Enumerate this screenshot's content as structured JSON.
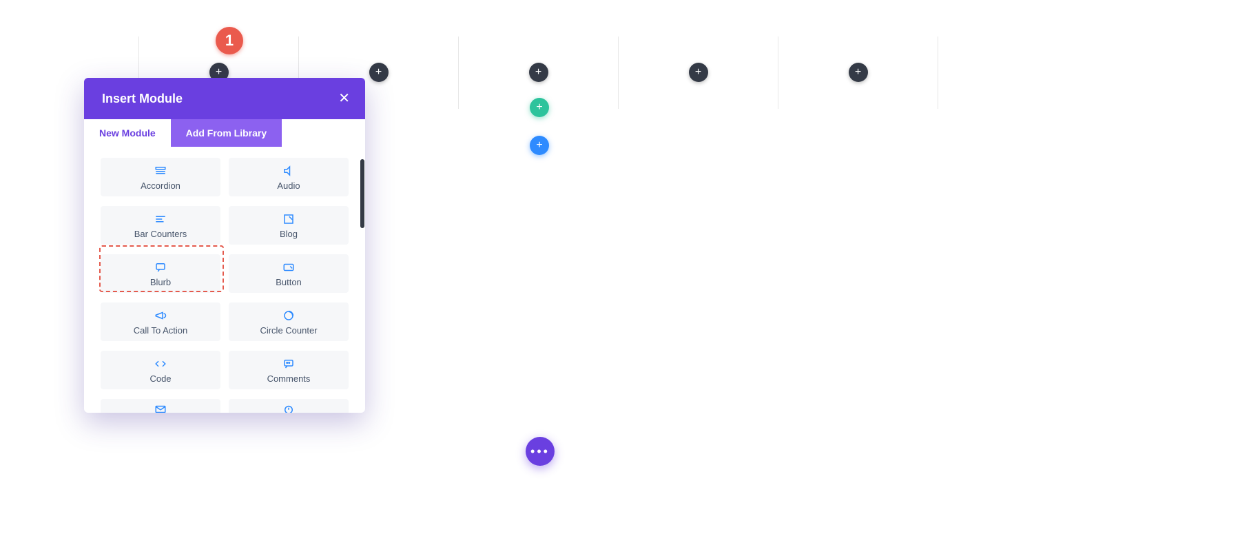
{
  "badge": {
    "number": "1"
  },
  "columns": {
    "add_icons": [
      "+",
      "+",
      "+",
      "+",
      "+"
    ],
    "teal_icon": "+",
    "blue_icon": "+"
  },
  "modal": {
    "title": "Insert Module",
    "close": "✕",
    "tabs": {
      "new": "New Module",
      "library": "Add From Library"
    },
    "modules": {
      "accordion": "Accordion",
      "audio": "Audio",
      "bar_counters": "Bar Counters",
      "blog": "Blog",
      "blurb": "Blurb",
      "button": "Button",
      "call_to_action": "Call To Action",
      "circle_counter": "Circle Counter",
      "code": "Code",
      "comments": "Comments"
    }
  },
  "fab": {
    "dots": "•••"
  }
}
